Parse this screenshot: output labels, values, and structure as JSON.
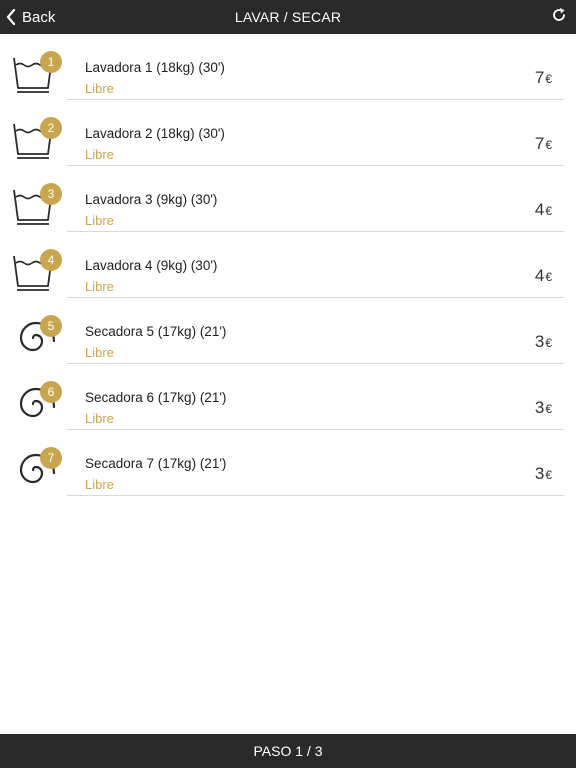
{
  "header": {
    "back_label": "Back",
    "title": "LAVAR / SECAR",
    "back_icon": "chevron-left-icon",
    "refresh_icon": "refresh-icon"
  },
  "colors": {
    "accent": "#c9a64e",
    "bar": "#2a2a2a",
    "divider": "#d9d9d9"
  },
  "machines": [
    {
      "number": "1",
      "type": "washer",
      "icon": "washer-icon",
      "name": "Lavadora 1 (18kg) (30')",
      "status": "Libre",
      "price": "7",
      "currency": "€"
    },
    {
      "number": "2",
      "type": "washer",
      "icon": "washer-icon",
      "name": "Lavadora 2 (18kg) (30')",
      "status": "Libre",
      "price": "7",
      "currency": "€"
    },
    {
      "number": "3",
      "type": "washer",
      "icon": "washer-icon",
      "name": "Lavadora 3 (9kg) (30')",
      "status": "Libre",
      "price": "4",
      "currency": "€"
    },
    {
      "number": "4",
      "type": "washer",
      "icon": "washer-icon",
      "name": "Lavadora 4 (9kg) (30')",
      "status": "Libre",
      "price": "4",
      "currency": "€"
    },
    {
      "number": "5",
      "type": "dryer",
      "icon": "dryer-icon",
      "name": "Secadora 5 (17kg) (21')",
      "status": "Libre",
      "price": "3",
      "currency": "€"
    },
    {
      "number": "6",
      "type": "dryer",
      "icon": "dryer-icon",
      "name": "Secadora 6 (17kg) (21')",
      "status": "Libre",
      "price": "3",
      "currency": "€"
    },
    {
      "number": "7",
      "type": "dryer",
      "icon": "dryer-icon",
      "name": "Secadora 7 (17kg) (21')",
      "status": "Libre",
      "price": "3",
      "currency": "€"
    }
  ],
  "footer": {
    "label": "PASO 1 / 3"
  }
}
